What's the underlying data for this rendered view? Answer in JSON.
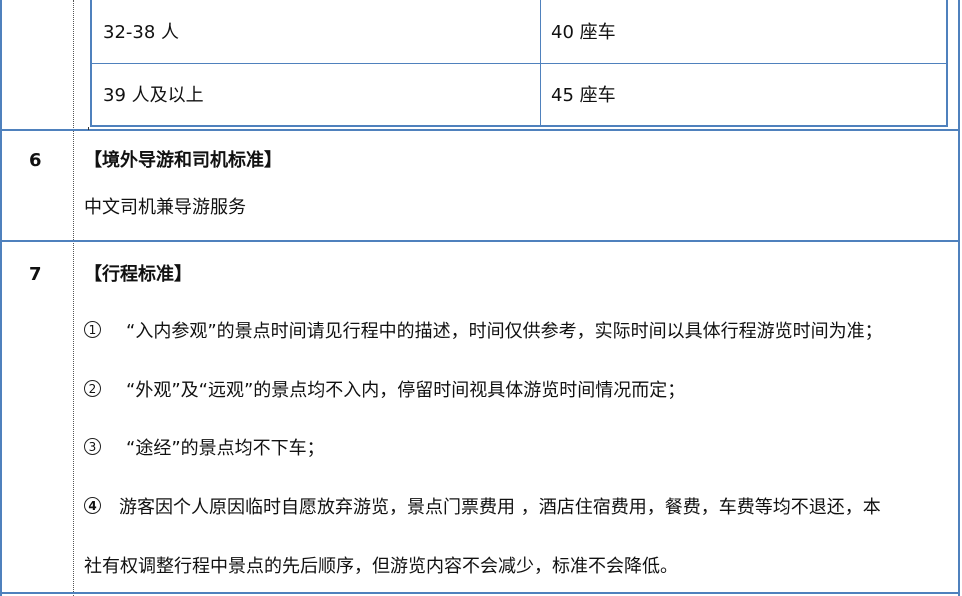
{
  "inner_table": {
    "rows": [
      {
        "people": "32-38 人",
        "vehicle": "40 座车"
      },
      {
        "people": "39 人及以上",
        "vehicle": "45 座车"
      }
    ]
  },
  "section6": {
    "number": "6",
    "heading": "【境外导游和司机标准】",
    "body": "中文司机兼导游服务"
  },
  "section7": {
    "number": "7",
    "heading": "【行程标准】",
    "items": [
      {
        "marker": "1",
        "text": "“入内参观”的景点时间请见行程中的描述，时间仅供参考，实际时间以具体行程游览时间为准；"
      },
      {
        "marker": "2",
        "text": "“外观”及“远观”的景点均不入内，停留时间视具体游览时间情况而定；"
      },
      {
        "marker": "3",
        "text": "“途经”的景点均不下车；"
      },
      {
        "marker": "4",
        "text": "游客因个人原因临时自愿放弃游览，景点门票费用 ，酒店住宿费用，餐费，车费等均不退还，本",
        "continuation": "社有权调整行程中景点的先后顺序，但游览内容不会减少，标准不会降低。"
      }
    ]
  },
  "colors": {
    "border_blue": "#4f81bd",
    "border_dark": "#333333"
  }
}
